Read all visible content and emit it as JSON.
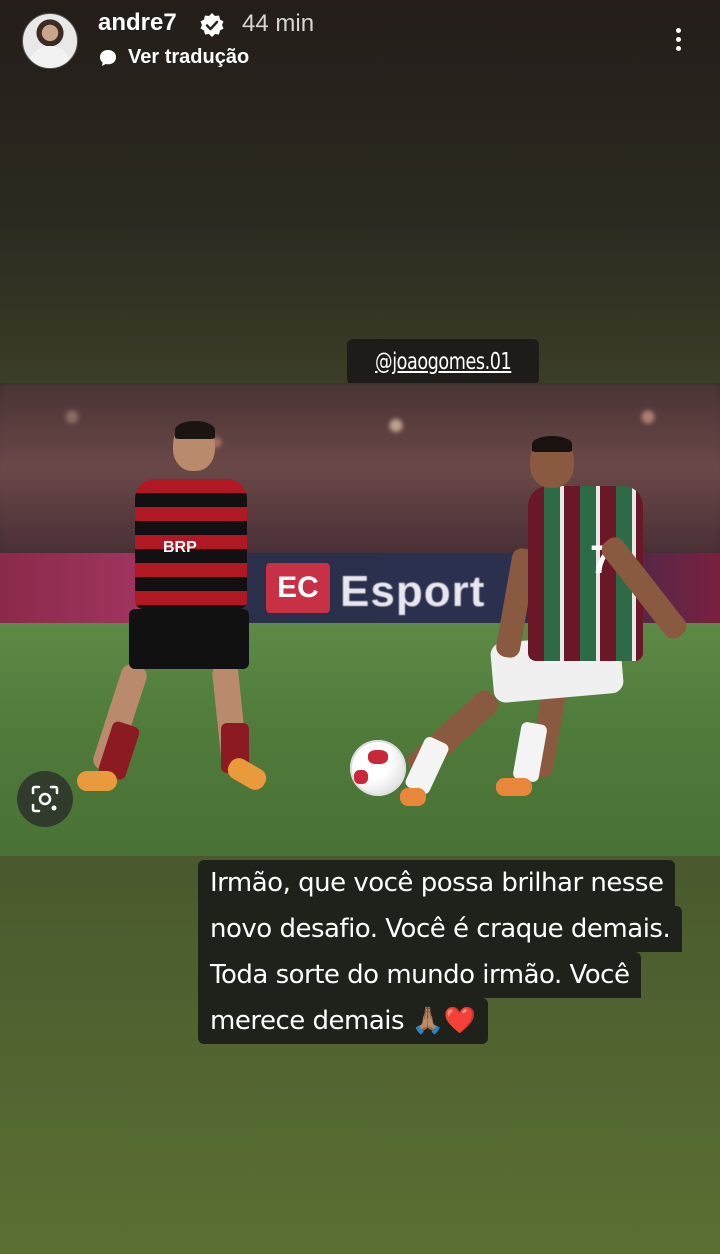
{
  "header": {
    "username": "andre7",
    "time": "44 min",
    "translate_label": "Ver tradução"
  },
  "story": {
    "mention": "@joaogomes.01",
    "photo_ad_text": "Esport",
    "photo_ad_badge": "EC",
    "player1_sponsor": "BRP",
    "player2_number": "7",
    "caption_lines": [
      "Irmão, que você possa brilhar nesse",
      "novo desafio. Você é craque demais.",
      "Toda sorte do mundo irmão. Você",
      "merece demais"
    ],
    "caption_emoji": "🙏🏽❤️"
  },
  "icons": {
    "verified": "verified-badge-icon",
    "translate": "speech-bubble-icon",
    "more": "more-options-icon",
    "lens": "visual-search-icon"
  },
  "colors": {
    "caption_bg": "#1f221a",
    "mention_bg": "#1e1c19"
  }
}
